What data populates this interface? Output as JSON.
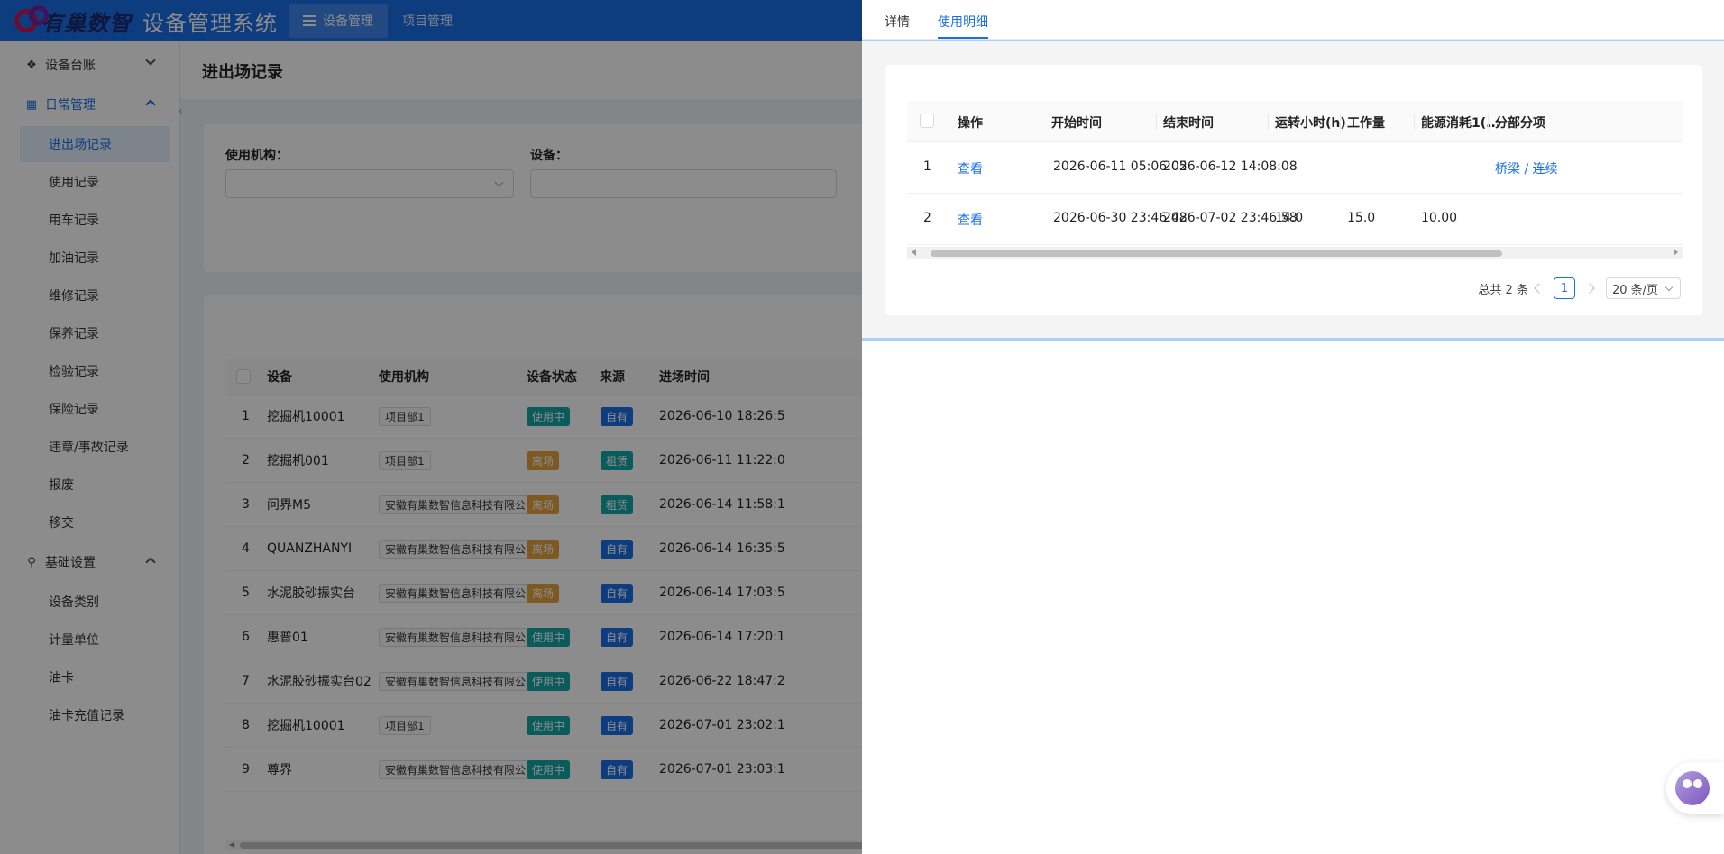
{
  "header": {
    "brand": "有巢数智",
    "title": "设备管理系统",
    "nav": [
      {
        "label": "设备管理",
        "active": true
      },
      {
        "label": "项目管理",
        "active": false
      }
    ]
  },
  "sidebar": {
    "groups": [
      {
        "label": "设备台账",
        "icon": "cube-icon",
        "open": false,
        "items": []
      },
      {
        "label": "日常管理",
        "icon": "grid-icon",
        "open": true,
        "items": [
          "进出场记录",
          "使用记录",
          "用车记录",
          "加油记录",
          "维修记录",
          "保养记录",
          "检验记录",
          "保险记录",
          "违章/事故记录",
          "报废",
          "移交"
        ]
      },
      {
        "label": "基础设置",
        "icon": "link-icon",
        "open": true,
        "items": [
          "设备类别",
          "计量单位",
          "油卡",
          "油卡充值记录"
        ]
      }
    ],
    "active_item": "进出场记录"
  },
  "page": {
    "title": "进出场记录",
    "filters": [
      {
        "label": "使用机构：",
        "value": ""
      },
      {
        "label": "设备：",
        "value": ""
      }
    ]
  },
  "main_table": {
    "columns": [
      "设备",
      "使用机构",
      "设备状态",
      "来源",
      "进场时间"
    ],
    "rows": [
      {
        "no": "1",
        "device": "挖掘机10001",
        "org": "项目部1",
        "status": "使用中",
        "source": "自有",
        "time": "2026-06-10 18:26:5"
      },
      {
        "no": "2",
        "device": "挖掘机001",
        "org": "项目部1",
        "status": "离场",
        "source": "租赁",
        "time": "2026-06-11 11:22:0"
      },
      {
        "no": "3",
        "device": "问界M5",
        "org": "安徽有巢数智信息科技有限公司",
        "status": "离场",
        "source": "租赁",
        "time": "2026-06-14 11:58:1"
      },
      {
        "no": "4",
        "device": "QUANZHANYI",
        "org": "安徽有巢数智信息科技有限公司",
        "status": "离场",
        "source": "自有",
        "time": "2026-06-14 16:35:5"
      },
      {
        "no": "5",
        "device": "水泥胶砂振实台",
        "org": "安徽有巢数智信息科技有限公司",
        "status": "离场",
        "source": "自有",
        "time": "2026-06-14 17:03:5"
      },
      {
        "no": "6",
        "device": "惠普01",
        "org": "安徽有巢数智信息科技有限公司",
        "status": "使用中",
        "source": "自有",
        "time": "2026-06-14 17:20:1"
      },
      {
        "no": "7",
        "device": "水泥胶砂振实台02",
        "org": "安徽有巢数智信息科技有限公司",
        "status": "使用中",
        "source": "自有",
        "time": "2026-06-22 18:47:2"
      },
      {
        "no": "8",
        "device": "挖掘机10001",
        "org": "项目部1",
        "status": "使用中",
        "source": "自有",
        "time": "2026-07-01 23:02:1"
      },
      {
        "no": "9",
        "device": "尊界",
        "org": "安徽有巢数智信息科技有限公司",
        "status": "使用中",
        "source": "自有",
        "time": "2026-07-01 23:03:1"
      }
    ]
  },
  "colors": {
    "primary": "#1a6fe8",
    "status_in_use": "#13a8a8",
    "status_left": "#e6a23c",
    "source_own": "#1a6fe8",
    "source_rent": "#13a8a8"
  },
  "drawer": {
    "tabs": [
      {
        "label": "详情",
        "active": false
      },
      {
        "label": "使用明细",
        "active": true
      }
    ],
    "table": {
      "columns": [
        "操作",
        "开始时间",
        "结束时间",
        "运转小时(h)",
        "工作量",
        "能源消耗1(...",
        "分部分项"
      ],
      "rows": [
        {
          "no": "1",
          "action": "查看",
          "start": "2026-06-11 05:06:05",
          "end": "2026-06-12 14:08:08",
          "hours": "",
          "work": "",
          "energy": "",
          "section": "桥梁 / 连续"
        },
        {
          "no": "2",
          "action": "查看",
          "start": "2026-06-30 23:46:48",
          "end": "2026-07-02 23:46:58",
          "hours": "14.0",
          "work": "15.0",
          "energy": "10.00",
          "section": ""
        }
      ]
    },
    "pagination": {
      "total_text": "总共 2 条",
      "current_page": "1",
      "page_size": "20 条/页"
    }
  }
}
